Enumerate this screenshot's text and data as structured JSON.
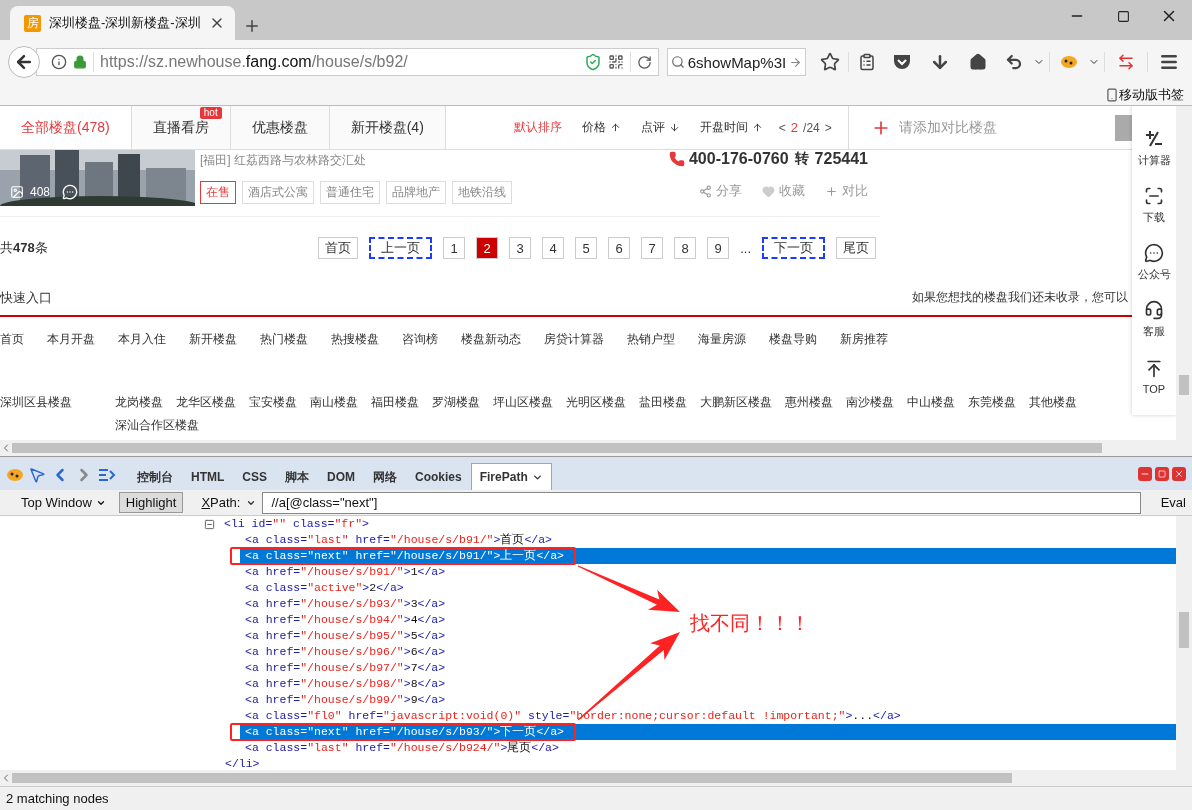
{
  "browser": {
    "tab": {
      "favicon": "房",
      "title": "深圳楼盘-深圳新楼盘-深圳"
    },
    "url": {
      "scheme_host": "https://sz.newhouse.",
      "domain": "fang.com",
      "path": "/house/s/b92/"
    },
    "search": {
      "value": "6showMap%3I"
    },
    "bookmark": "移动版书签"
  },
  "site": {
    "tabs": [
      {
        "label": "全部楼盘(478)",
        "selected": true
      },
      {
        "label": "直播看房",
        "selected": false,
        "badge": "hot"
      },
      {
        "label": "优惠楼盘",
        "selected": false
      },
      {
        "label": "新开楼盘(4)",
        "selected": false
      }
    ],
    "sorts": [
      {
        "label": "默认排序",
        "selected": true
      },
      {
        "label": "价格",
        "selected": false,
        "ascending": true
      },
      {
        "label": "点评",
        "selected": false,
        "ascending": false
      },
      {
        "label": "开盘时间",
        "selected": false,
        "ascending": true
      }
    ],
    "pager": {
      "prev": "<",
      "current": "2",
      "total": "/24",
      "next": ">"
    },
    "compare_prompt": "请添加对比楼盘",
    "listing": {
      "photo_count": "408",
      "address": "[福田] 红荔西路与农林路交汇处",
      "phone": "400-176-0760",
      "ext_label": "转",
      "ext": "725441",
      "tags": [
        {
          "label": "在售",
          "kind": "status"
        },
        {
          "label": "酒店式公寓",
          "kind": "feature"
        },
        {
          "label": "普通住宅",
          "kind": "feature"
        },
        {
          "label": "品牌地产",
          "kind": "feature"
        },
        {
          "label": "地铁沿线",
          "kind": "feature"
        }
      ],
      "actions": [
        {
          "label": "分享",
          "kind": "share"
        },
        {
          "label": "收藏",
          "kind": "favorite"
        },
        {
          "label": "对比",
          "kind": "compare"
        }
      ]
    },
    "pagination": {
      "total": "共**478**条",
      "pages": [
        {
          "label": "首页",
          "kind": "page",
          "selected": false,
          "outlined": false
        },
        {
          "label": "上一页",
          "kind": "page",
          "selected": false,
          "outlined": true
        },
        {
          "label": "1",
          "kind": "page",
          "selected": false,
          "outlined": false
        },
        {
          "label": "2",
          "kind": "page",
          "selected": true,
          "outlined": false
        },
        {
          "label": "3",
          "kind": "page",
          "selected": false,
          "outlined": false
        },
        {
          "label": "4",
          "kind": "page",
          "selected": false,
          "outlined": false
        },
        {
          "label": "5",
          "kind": "page",
          "selected": false,
          "outlined": false
        },
        {
          "label": "6",
          "kind": "page",
          "selected": false,
          "outlined": false
        },
        {
          "label": "7",
          "kind": "page",
          "selected": false,
          "outlined": false
        },
        {
          "label": "8",
          "kind": "page",
          "selected": false,
          "outlined": false
        },
        {
          "label": "9",
          "kind": "page",
          "selected": false,
          "outlined": false
        },
        {
          "label": "...",
          "kind": "ellipsis"
        },
        {
          "label": "下一页",
          "kind": "page",
          "selected": false,
          "outlined": true
        },
        {
          "label": "尾页",
          "kind": "page",
          "selected": false,
          "outlined": false
        }
      ]
    },
    "quick_entry": {
      "title": "快速入口",
      "notice": "如果您想找的楼盘我们还未收录，您可以"
    },
    "links": [
      "首页",
      "本月开盘",
      "本月入住",
      "新开楼盘",
      "热门楼盘",
      "热搜楼盘",
      "咨询榜",
      "楼盘新动态",
      "房贷计算器",
      "热销户型",
      "海量房源",
      "楼盘导购",
      "新房推荐"
    ],
    "districts": {
      "title": "深圳区县楼盘",
      "items": [
        "龙岗楼盘",
        "龙华区楼盘",
        "宝安楼盘",
        "南山楼盘",
        "福田楼盘",
        "罗湖楼盘",
        "坪山区楼盘",
        "光明区楼盘",
        "盐田楼盘",
        "大鹏新区楼盘",
        "惠州楼盘",
        "南沙楼盘",
        "中山楼盘",
        "东莞楼盘",
        "其他楼盘",
        "深汕合作区楼盘"
      ]
    },
    "side_tools": [
      {
        "label": "计算器",
        "kind": "calculator"
      },
      {
        "label": "下载",
        "kind": "download"
      },
      {
        "label": "公众号",
        "kind": "wechat"
      },
      {
        "label": "客服",
        "kind": "service"
      },
      {
        "label": "TOP",
        "kind": "top"
      }
    ]
  },
  "devtools": {
    "tabs": [
      {
        "label": "控制台",
        "selected": false
      },
      {
        "label": "HTML",
        "selected": false
      },
      {
        "label": "CSS",
        "selected": false
      },
      {
        "label": "脚本",
        "selected": false
      },
      {
        "label": "DOM",
        "selected": false
      },
      {
        "label": "网络",
        "selected": false
      },
      {
        "label": "Cookies",
        "selected": false
      },
      {
        "label": "FirePath",
        "selected": true
      }
    ],
    "context": "Top Window",
    "highlight": {
      "label": "Highlight",
      "on": true
    },
    "xpath_label": "XPath:",
    "xpath": "//a[@class=\"next\"]",
    "eval": "Eval",
    "dom": [
      {
        "open": "<li id=\"\" class=\"fr\">",
        "expanded": true,
        "close": "</li>",
        "children": [
          {
            "line": "<a class=\"last\" href=\"/house/s/b91/\">首页</a>",
            "selected": false,
            "circled": false
          },
          {
            "line": "<a class=\"next\" href=\"/house/s/b91/\">上一页</a>",
            "selected": true,
            "circled": true
          },
          {
            "line": "<a href=\"/house/s/b91/\">1</a>",
            "selected": false,
            "circled": false
          },
          {
            "line": "<a class=\"active\">2</a>",
            "selected": false,
            "circled": false
          },
          {
            "line": "<a href=\"/house/s/b93/\">3</a>",
            "selected": false,
            "circled": false
          },
          {
            "line": "<a href=\"/house/s/b94/\">4</a>",
            "selected": false,
            "circled": false
          },
          {
            "line": "<a href=\"/house/s/b95/\">5</a>",
            "selected": false,
            "circled": false
          },
          {
            "line": "<a href=\"/house/s/b96/\">6</a>",
            "selected": false,
            "circled": false
          },
          {
            "line": "<a href=\"/house/s/b97/\">7</a>",
            "selected": false,
            "circled": false
          },
          {
            "line": "<a href=\"/house/s/b98/\">8</a>",
            "selected": false,
            "circled": false
          },
          {
            "line": "<a href=\"/house/s/b99/\">9</a>",
            "selected": false,
            "circled": false
          },
          {
            "line": "<a class=\"fl0\" href=\"javascript:void(0)\" style=\"border:none;cursor:default !important;\">...</a>",
            "selected": false,
            "circled": false
          },
          {
            "line": "<a class=\"next\" href=\"/house/s/b93/\">下一页</a>",
            "selected": true,
            "circled": true
          },
          {
            "line": "<a class=\"last\" href=\"/house/s/b924/\">尾页</a>",
            "selected": false,
            "circled": false
          }
        ]
      }
    ],
    "note": "找不同！！！",
    "status": "2 matching nodes"
  }
}
